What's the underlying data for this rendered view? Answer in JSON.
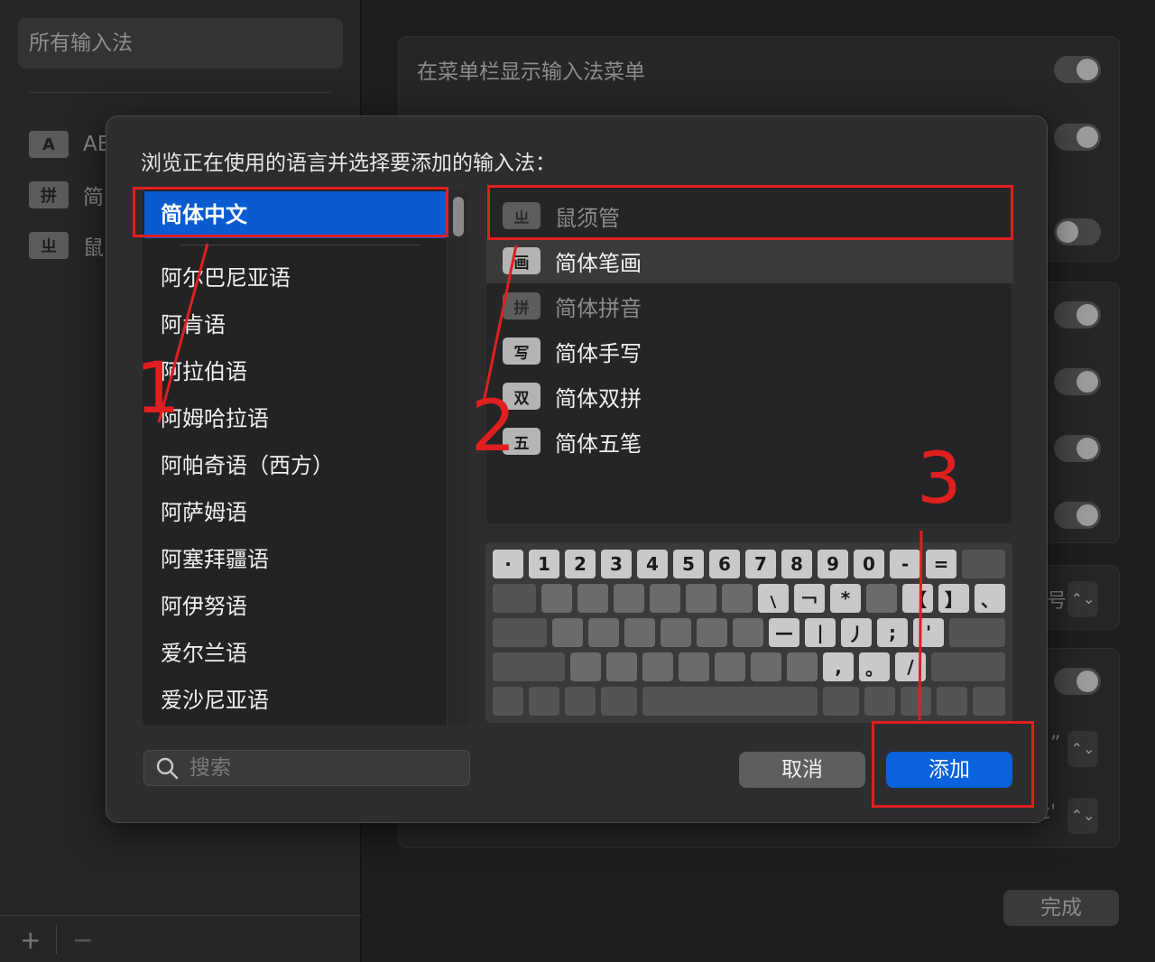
{
  "sidebar": {
    "title": "所有输入法",
    "rows": [
      {
        "badge": "A",
        "label": "AB"
      },
      {
        "badge": "拼",
        "label": "简"
      },
      {
        "badge": "ㄓ",
        "label": "鼠"
      }
    ],
    "add_symbol": "+",
    "remove_symbol": "−"
  },
  "settings": {
    "show_menu_label": "在菜单栏显示输入法菜单",
    "partial_labels": [
      "号",
      "”",
      "c'"
    ],
    "done_label": "完成"
  },
  "dialog": {
    "title": "浏览正在使用的语言并选择要添加的输入法：",
    "languages": {
      "selected": "简体中文",
      "items": [
        "阿尔巴尼亚语",
        "阿肯语",
        "阿拉伯语",
        "阿姆哈拉语",
        "阿帕奇语（西方）",
        "阿萨姆语",
        "阿塞拜疆语",
        "阿伊努语",
        "爱尔兰语",
        "爱沙尼亚语"
      ]
    },
    "input_methods": [
      {
        "badge": "ㄓ",
        "name": "鼠须管",
        "enabled": false
      },
      {
        "badge": "画",
        "name": "简体笔画",
        "enabled": true
      },
      {
        "badge": "拼",
        "name": "简体拼音",
        "enabled": false
      },
      {
        "badge": "写",
        "name": "简体手写",
        "enabled": true
      },
      {
        "badge": "双",
        "name": "简体双拼",
        "enabled": true
      },
      {
        "badge": "五",
        "name": "简体五笔",
        "enabled": true
      }
    ],
    "keyboard": {
      "row1": [
        "·",
        "1",
        "2",
        "3",
        "4",
        "5",
        "6",
        "7",
        "8",
        "9",
        "0",
        "-",
        "="
      ],
      "row2_marks": [
        "﹨",
        "￢",
        "*",
        "【",
        "】",
        "、"
      ],
      "row3_marks": [
        "—",
        "|",
        "丿",
        ";",
        "'"
      ],
      "row4_marks": [
        ",",
        "。",
        "/"
      ]
    },
    "search_placeholder": "搜索",
    "cancel_label": "取消",
    "add_label": "添加"
  },
  "annotations": {
    "labels": [
      "1",
      "2",
      "3"
    ],
    "color": "#e01f1f"
  },
  "colors": {
    "accent": "#0a62dc",
    "selection": "#0a5bd0",
    "dialog_bg": "#2d2d2f"
  }
}
